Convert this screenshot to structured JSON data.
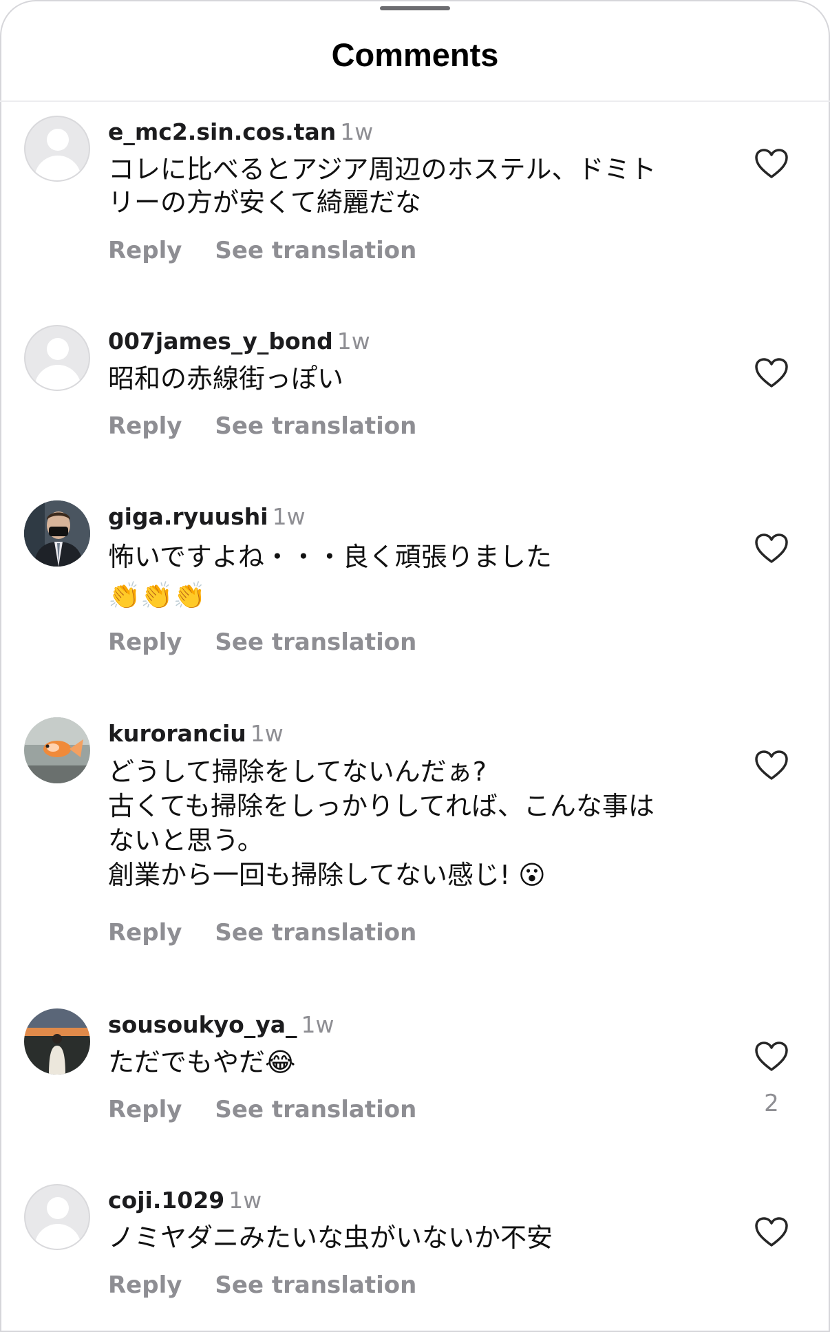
{
  "header": {
    "title": "Comments"
  },
  "actions": {
    "reply": "Reply",
    "translate": "See translation"
  },
  "comments": [
    {
      "username": "e_mc2.sin.cos.tan",
      "time": "1w",
      "text": "コレに比べるとアジア周辺のホステル、ドミト\nリーの方が安くて綺麗だな",
      "avatar": "default-avatar"
    },
    {
      "username": "007james_y_bond",
      "time": "1w",
      "text": "昭和の赤線街っぽい",
      "avatar": "default-avatar"
    },
    {
      "username": "giga.ryuushi",
      "time": "1w",
      "text": "怖いですよね・・・良く頑張りました\n👏👏👏",
      "avatar": "person-in-suit-photo"
    },
    {
      "username": "kuroranciu",
      "time": "1w",
      "text": "どうして掃除をしてないんだぁ?\n古くても掃除をしっかりしてれば、こんな事は\nないと思う。\n創業から一回も掃除してない感じ! 😮",
      "avatar": "goldfish-photo"
    },
    {
      "username": "sousoukyo_ya_",
      "time": "1w",
      "text": "ただでもやだ😂",
      "avatar": "sunset-person-photo",
      "likes": "2"
    },
    {
      "username": "coji.1029",
      "time": "1w",
      "text": "ノミヤダニみたいな虫がいないか不安",
      "avatar": "default-avatar"
    }
  ]
}
